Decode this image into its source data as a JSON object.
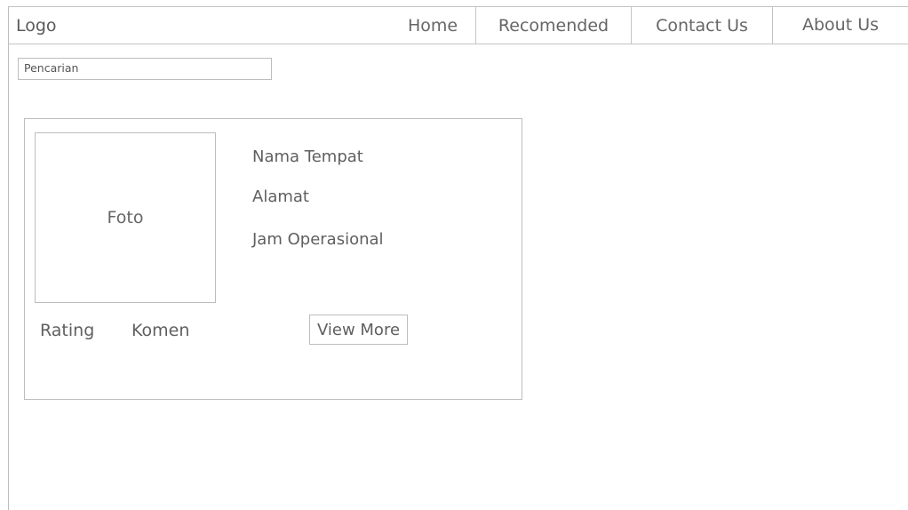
{
  "header": {
    "logo": "Logo",
    "nav": {
      "home": "Home",
      "recomended": "Recomended",
      "contact": "Contact Us",
      "about": "About Us"
    }
  },
  "search": {
    "placeholder": "Pencarian"
  },
  "card": {
    "photo_label": "Foto",
    "name": "Nama Tempat",
    "address": "Alamat",
    "hours": "Jam Operasional",
    "rating_label": "Rating",
    "comment_label": "Komen",
    "view_more_label": "View More"
  }
}
